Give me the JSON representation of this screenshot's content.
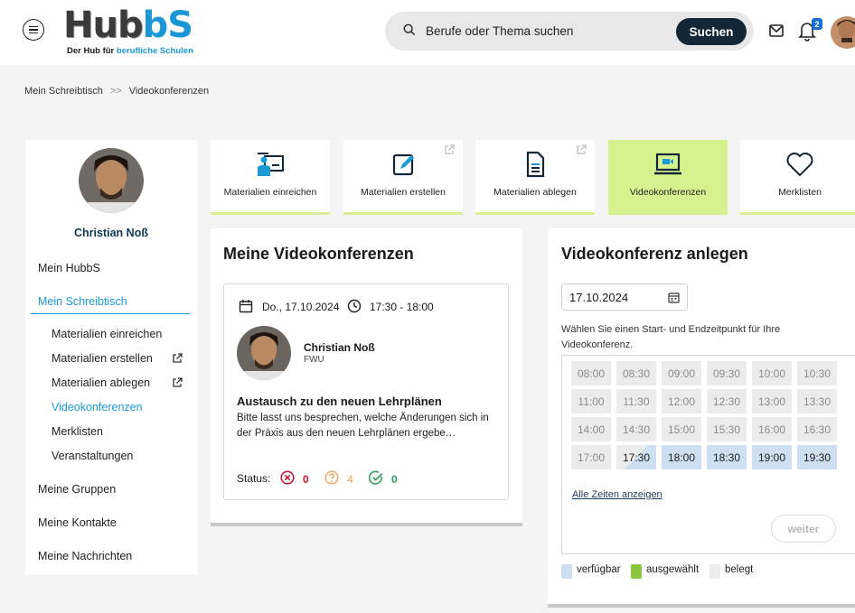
{
  "header": {
    "logo_text_a": "Hub",
    "logo_text_b": "bS",
    "logo_sub_a": "Der Hub für ",
    "logo_sub_b": "berufliche Schulen",
    "search_placeholder": "Berufe oder Thema suchen",
    "search_button": "Suchen",
    "notification_count": "2"
  },
  "breadcrumb": {
    "items": [
      "Mein Schreibtisch",
      "Videokonferenzen"
    ],
    "separator": ">>"
  },
  "sidebar": {
    "user_name": "Christian Noß",
    "items": [
      {
        "label": "Mein HubbS"
      },
      {
        "label": "Mein Schreibtisch"
      },
      {
        "label": "Materialien einreichen"
      },
      {
        "label": "Materialien erstellen"
      },
      {
        "label": "Materialien ablegen"
      },
      {
        "label": "Videokonferenzen"
      },
      {
        "label": "Merklisten"
      },
      {
        "label": "Veranstaltungen"
      },
      {
        "label": "Meine Gruppen"
      },
      {
        "label": "Meine Kontakte"
      },
      {
        "label": "Meine Nachrichten"
      }
    ]
  },
  "tiles": [
    {
      "label": "Materialien einreichen",
      "icon": "presenter-icon"
    },
    {
      "label": "Materialien erstellen",
      "icon": "edit-icon"
    },
    {
      "label": "Materialien ablegen",
      "icon": "document-icon"
    },
    {
      "label": "Videokonferenzen",
      "icon": "laptop-video-icon"
    },
    {
      "label": "Merklisten",
      "icon": "heart-icon"
    }
  ],
  "my_conferences": {
    "title": "Meine Videokonferenzen",
    "card": {
      "date": "Do., 17.10.2024",
      "time": "17:30 - 18:00",
      "host_name": "Christian Noß",
      "host_org": "FWU",
      "title": "Austausch zu den neuen Lehrplänen",
      "description": "Bitte lasst uns besprechen, welche Änderungen sich in der Präxis aus den neuen Lehrplänen ergebe…",
      "status_label": "Status:",
      "declined": "0",
      "pending": "4",
      "accepted": "0"
    }
  },
  "create_conference": {
    "title": "Videokonferenz anlegen",
    "date_value": "17.10.2024",
    "hint": "Wählen Sie einen Start- und Endzeitpunkt für Ihre Videokonferenz.",
    "slots": [
      [
        "08:00",
        "08:30",
        "09:00",
        "09:30",
        "10:00",
        "10:30"
      ],
      [
        "11:00",
        "11:30",
        "12:00",
        "12:30",
        "13:00",
        "13:30"
      ],
      [
        "14:00",
        "14:30",
        "15:00",
        "15:30",
        "16:00",
        "16:30"
      ],
      [
        "17:00",
        "17:30",
        "18:00",
        "18:30",
        "19:00",
        "19:30"
      ]
    ],
    "available": [
      "18:00",
      "18:30",
      "19:00",
      "19:30"
    ],
    "partial": [
      "17:30"
    ],
    "all_times_link": "Alle Zeiten anzeigen",
    "next_button": "weiter",
    "legend": {
      "available": "verfügbar",
      "selected": "ausgewählt",
      "occupied": "belegt"
    }
  },
  "colors": {
    "accent_blue": "#1b9ad8",
    "dark_navy": "#142737",
    "tile_selected": "#d6f28f",
    "slot_available": "#cddff0",
    "slot_selected": "#8cc63f",
    "declined_red": "#d0112b",
    "pending_orange": "#f0a35a",
    "accepted_green": "#2e9a57"
  }
}
